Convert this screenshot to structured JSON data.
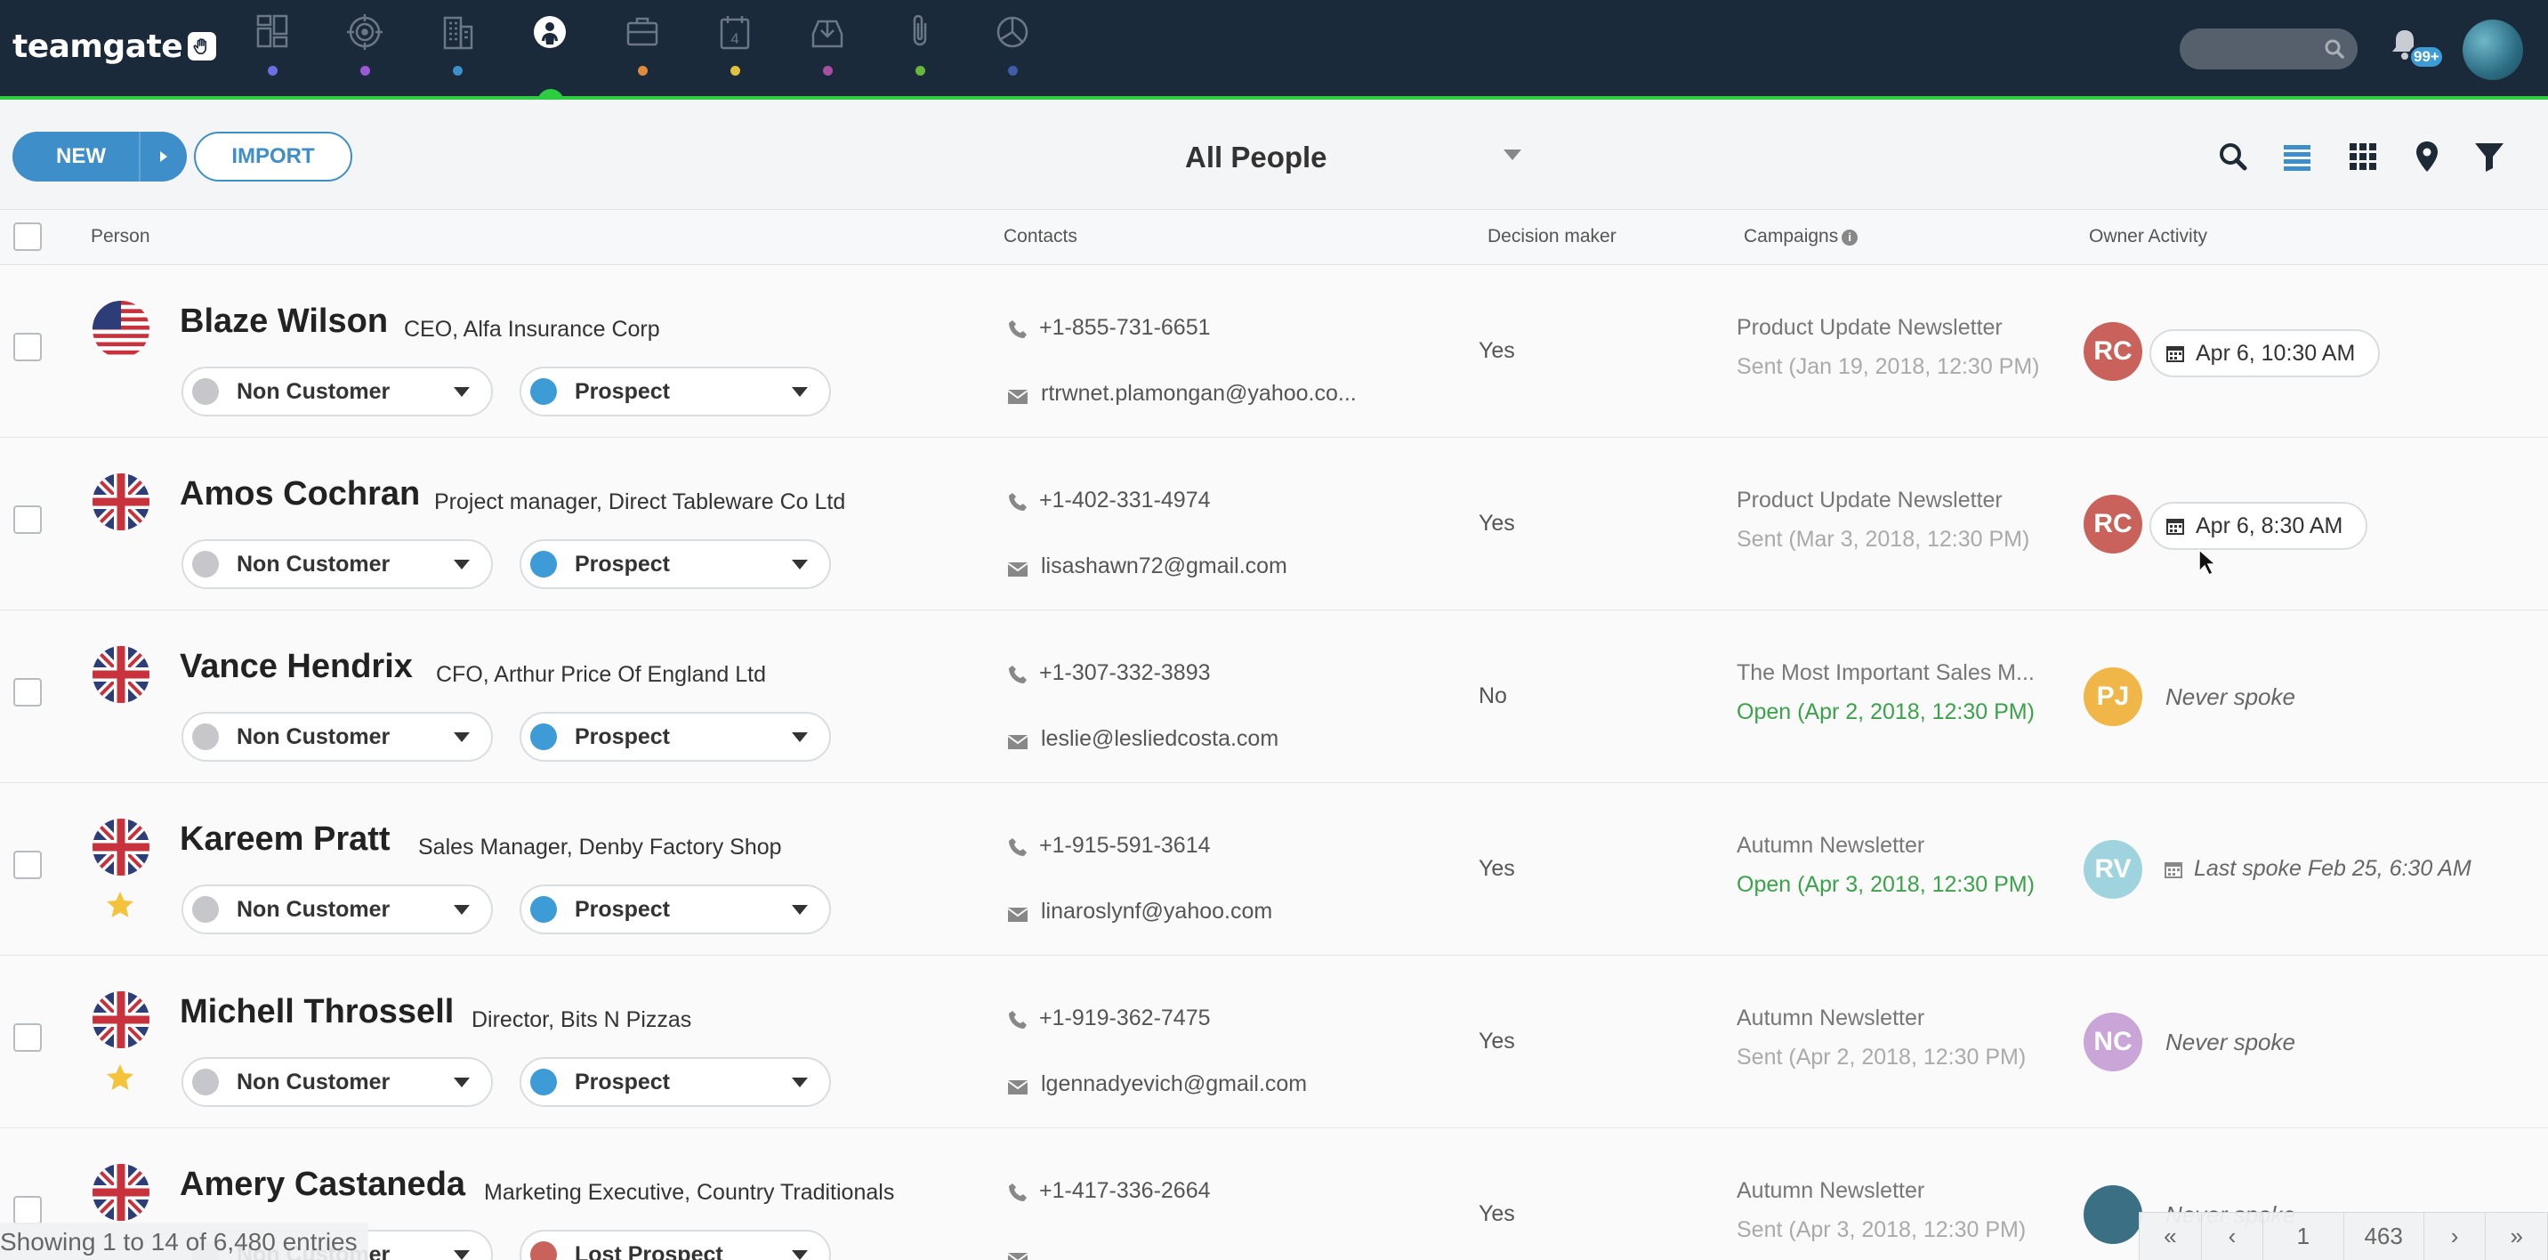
{
  "app": {
    "logo_text": "teamgate",
    "notifications_badge": "99+",
    "accent_color": "#3d8ec9",
    "nav_colors": [
      "#6b6fe0",
      "#9a59d6",
      "#3d8ec9",
      "#ffffff",
      "#e08a3c",
      "#e0c13c",
      "#a84fa0",
      "#6ab83a",
      "#3e5fa8"
    ],
    "nav_icons": [
      "dashboard-icon",
      "target-icon",
      "companies-icon",
      "people-icon",
      "deals-icon",
      "calendar-icon",
      "download-icon",
      "files-icon",
      "reports-icon"
    ]
  },
  "toolbar": {
    "new_label": "NEW",
    "import_label": "IMPORT",
    "view_title": "All People",
    "icons": [
      "search-icon",
      "list-view-icon",
      "grid-view-icon",
      "map-pin-icon",
      "filter-icon"
    ]
  },
  "calendar_digit": "4",
  "table": {
    "headers": {
      "person": "Person",
      "contacts": "Contacts",
      "decision_maker": "Decision maker",
      "campaigns": "Campaigns",
      "owner_activity": "Owner Activity"
    },
    "rows": [
      {
        "name": "Blaze Wilson",
        "title": "CEO, Alfa Insurance Corp",
        "flag": "us",
        "starred": false,
        "status": "Non Customer",
        "stage": "Prospect",
        "stage_color": "#3d9bd6",
        "phone": "+1-855-731-6651",
        "email": "rtrwnet.plamongan@yahoo.co...",
        "decision": "Yes",
        "campaign": "Product Update Newsletter",
        "campaign_status": "Sent (Jan 19, 2018, 12:30 PM)",
        "campaign_open": false,
        "owner_initials": "RC",
        "owner_color": "#c9625a",
        "activity": "Apr 6, 10:30 AM",
        "activity_type": "chip"
      },
      {
        "name": "Amos Cochran",
        "title": "Project manager, Direct Tableware Co Ltd",
        "flag": "uk",
        "starred": false,
        "status": "Non Customer",
        "stage": "Prospect",
        "stage_color": "#3d9bd6",
        "phone": "+1-402-331-4974",
        "email": "lisashawn72@gmail.com",
        "decision": "Yes",
        "campaign": "Product Update Newsletter",
        "campaign_status": "Sent (Mar 3, 2018, 12:30 PM)",
        "campaign_open": false,
        "owner_initials": "RC",
        "owner_color": "#c9625a",
        "activity": "Apr 6, 8:30 AM",
        "activity_type": "chip"
      },
      {
        "name": "Vance Hendrix",
        "title": "CFO, Arthur Price Of England Ltd",
        "flag": "uk",
        "starred": false,
        "status": "Non Customer",
        "stage": "Prospect",
        "stage_color": "#3d9bd6",
        "phone": "+1-307-332-3893",
        "email": "leslie@lesliedcosta.com",
        "decision": "No",
        "campaign": "The Most Important Sales M...",
        "campaign_status": "Open (Apr 2, 2018, 12:30 PM)",
        "campaign_open": true,
        "owner_initials": "PJ",
        "owner_color": "#f0b648",
        "activity": "Never spoke",
        "activity_type": "never"
      },
      {
        "name": "Kareem Pratt",
        "title": "Sales Manager, Denby Factory Shop",
        "flag": "uk",
        "starred": true,
        "status": "Non Customer",
        "stage": "Prospect",
        "stage_color": "#3d9bd6",
        "phone": "+1-915-591-3614",
        "email": "linaroslynf@yahoo.com",
        "decision": "Yes",
        "campaign": "Autumn Newsletter",
        "campaign_status": "Open (Apr 3, 2018, 12:30 PM)",
        "campaign_open": true,
        "owner_initials": "RV",
        "owner_color": "#9fd4de",
        "activity": "Last spoke Feb 25, 6:30 AM",
        "activity_type": "lastspoke"
      },
      {
        "name": "Michell Throssell",
        "title": "Director, Bits N Pizzas",
        "flag": "uk",
        "starred": true,
        "status": "Non Customer",
        "stage": "Prospect",
        "stage_color": "#3d9bd6",
        "phone": "+1-919-362-7475",
        "email": "lgennadyevich@gmail.com",
        "decision": "Yes",
        "campaign": "Autumn Newsletter",
        "campaign_status": "Sent (Apr 2, 2018, 12:30 PM)",
        "campaign_open": false,
        "owner_initials": "NC",
        "owner_color": "#c9a5d8",
        "activity": "Never spoke",
        "activity_type": "never"
      },
      {
        "name": "Amery Castaneda",
        "title": "Marketing Executive, Country Traditionals",
        "flag": "uk",
        "starred": false,
        "status": "Non Customer",
        "stage": "Lost Prospect",
        "stage_color": "#c9625a",
        "phone": "+1-417-336-2664",
        "email": "",
        "decision": "Yes",
        "campaign": "Autumn Newsletter",
        "campaign_status": "Sent (Apr 3, 2018, 12:30 PM)",
        "campaign_open": false,
        "owner_initials": "",
        "owner_color": "#3a6f84",
        "activity": "Never spoke",
        "activity_type": "never"
      }
    ]
  },
  "footer": {
    "entries_info": "Showing 1 to 14 of 6,480 entries",
    "pager": {
      "first": "«",
      "prev": "‹",
      "page": "1",
      "total": "463",
      "next": "›",
      "last": "»"
    }
  }
}
